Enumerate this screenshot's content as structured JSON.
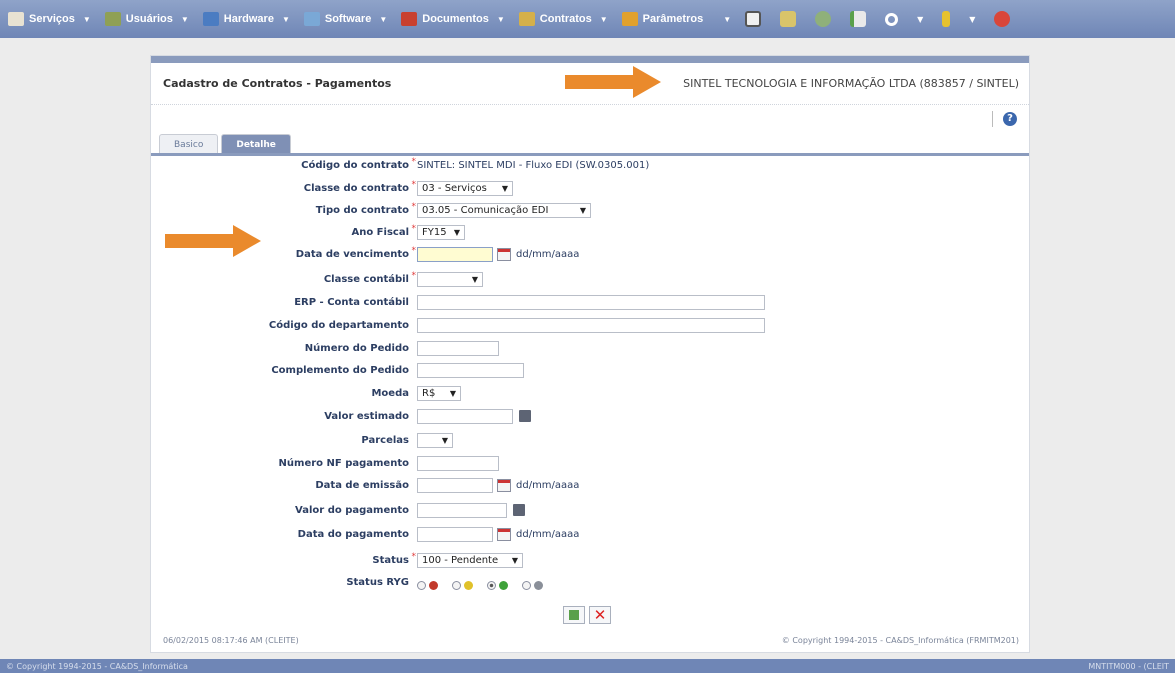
{
  "menubar": {
    "items": [
      {
        "label": "Serviços",
        "color": "#e8e2d2"
      },
      {
        "label": "Usuários",
        "color": "#8fa055"
      },
      {
        "label": "Hardware",
        "color": "#4b7cc2"
      },
      {
        "label": "Software",
        "color": "#7aa8d6"
      },
      {
        "label": "Documentos",
        "color": "#c9402f"
      },
      {
        "label": "Contratos",
        "color": "#d5b04a"
      },
      {
        "label": "Parâmetros",
        "color": "#e1a12e"
      }
    ],
    "tool_icons": [
      "monitor-icon",
      "note-icon",
      "gear-icon",
      "export-icon",
      "search-icon",
      "bottle-icon",
      "close-icon"
    ]
  },
  "panel": {
    "title": "Cadastro de Contratos - Pagamentos",
    "company": "SINTEL TECNOLOGIA E INFORMAÇÃO LTDA (883857 / SINTEL)",
    "help": "?"
  },
  "tabs": {
    "basic": "Basico",
    "detail": "Detalhe"
  },
  "form": {
    "codigo": {
      "label": "Código do contrato",
      "value": "SINTEL: SINTEL MDI - Fluxo EDI (SW.0305.001)"
    },
    "classe": {
      "label": "Classe do contrato",
      "value": "03 - Serviços"
    },
    "tipo": {
      "label": "Tipo do contrato",
      "value": "03.05 - Comunicação EDI"
    },
    "ano": {
      "label": "Ano Fiscal",
      "value": "FY15"
    },
    "vencimento": {
      "label": "Data de vencimento",
      "hint": "dd/mm/aaaa"
    },
    "classe_contabil": {
      "label": "Classe contábil",
      "value": ""
    },
    "erp": {
      "label": "ERP - Conta contábil"
    },
    "departamento": {
      "label": "Código do departamento"
    },
    "pedido": {
      "label": "Número do Pedido"
    },
    "complemento": {
      "label": "Complemento do Pedido"
    },
    "moeda": {
      "label": "Moeda",
      "value": "R$"
    },
    "valor_estimado": {
      "label": "Valor estimado"
    },
    "parcelas": {
      "label": "Parcelas",
      "value": ""
    },
    "nf": {
      "label": "Número NF pagamento"
    },
    "emissao": {
      "label": "Data de emissão",
      "hint": "dd/mm/aaaa"
    },
    "valor_pagamento": {
      "label": "Valor do pagamento"
    },
    "data_pagamento": {
      "label": "Data do pagamento",
      "hint": "dd/mm/aaaa"
    },
    "status": {
      "label": "Status",
      "value": "100 - Pendente"
    },
    "status_ryg": {
      "label": "Status RYG",
      "options": [
        {
          "color": "#c23a2b",
          "selected": false
        },
        {
          "color": "#e0c12a",
          "selected": false
        },
        {
          "color": "#3fa23a",
          "selected": true
        },
        {
          "color": "#8a8f99",
          "selected": false
        }
      ]
    }
  },
  "footer": {
    "timestamp": "06/02/2015 08:17:46 AM (CLEITE)",
    "copyright": "© Copyright 1994-2015 - CA&DS_Informática (FRMITM201)"
  },
  "statusbar": {
    "left": "© Copyright 1994-2015 - CA&DS_Informática",
    "right": "MNTITM000 - (CLEIT"
  },
  "annotation_color": "#ea8a2c"
}
